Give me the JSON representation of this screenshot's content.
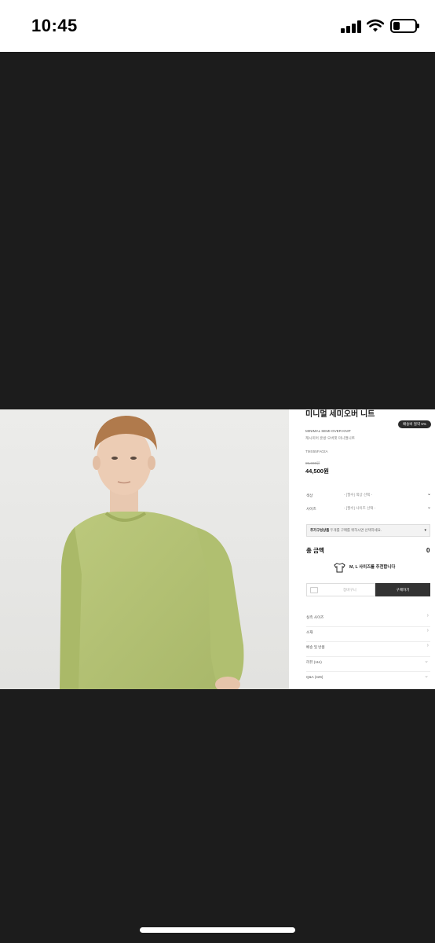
{
  "status_bar": {
    "time": "10:45",
    "icons": [
      "signal-icon",
      "wifi-icon",
      "battery-icon"
    ]
  },
  "product": {
    "name": "미니멀 세미오버 니트",
    "badge": "배송비 절약 5%",
    "english_name": "MINIMAL SEMI-OVER KNIT",
    "description": "캐시미어 혼방 오버핏 미니멀니트",
    "code": "TMS55FA02A",
    "original_price": "89,000원",
    "price": "44,500원"
  },
  "options": [
    {
      "label": "색상",
      "placeholder": "- [필수] 색상 선택 -"
    },
    {
      "label": "사이즈",
      "placeholder": "- [필수] 사이즈 선택 -"
    }
  ],
  "additional": {
    "title": "추가구성상품",
    "text": "두개를 구매를 위하시면 선택하세요."
  },
  "total": {
    "label": "총 금액",
    "value": "0"
  },
  "recommendation": "M, L 사이즈를 추천합니다",
  "actions": {
    "cart": "장바구니",
    "buy": "구매하기"
  },
  "accordion": [
    {
      "label": "실측 사이즈",
      "icon": "chevron-right-icon"
    },
    {
      "label": "소재",
      "icon": "chevron-right-icon"
    },
    {
      "label": "배송 및 반품",
      "icon": "chevron-right-icon"
    },
    {
      "label": "리뷰 (111)",
      "icon": "chevron-down-icon"
    },
    {
      "label": "Q&A (426)",
      "icon": "chevron-down-icon"
    }
  ],
  "colors": {
    "background": "#1c1c1c",
    "sweater": "#b4c274",
    "buy_button": "#333333"
  }
}
